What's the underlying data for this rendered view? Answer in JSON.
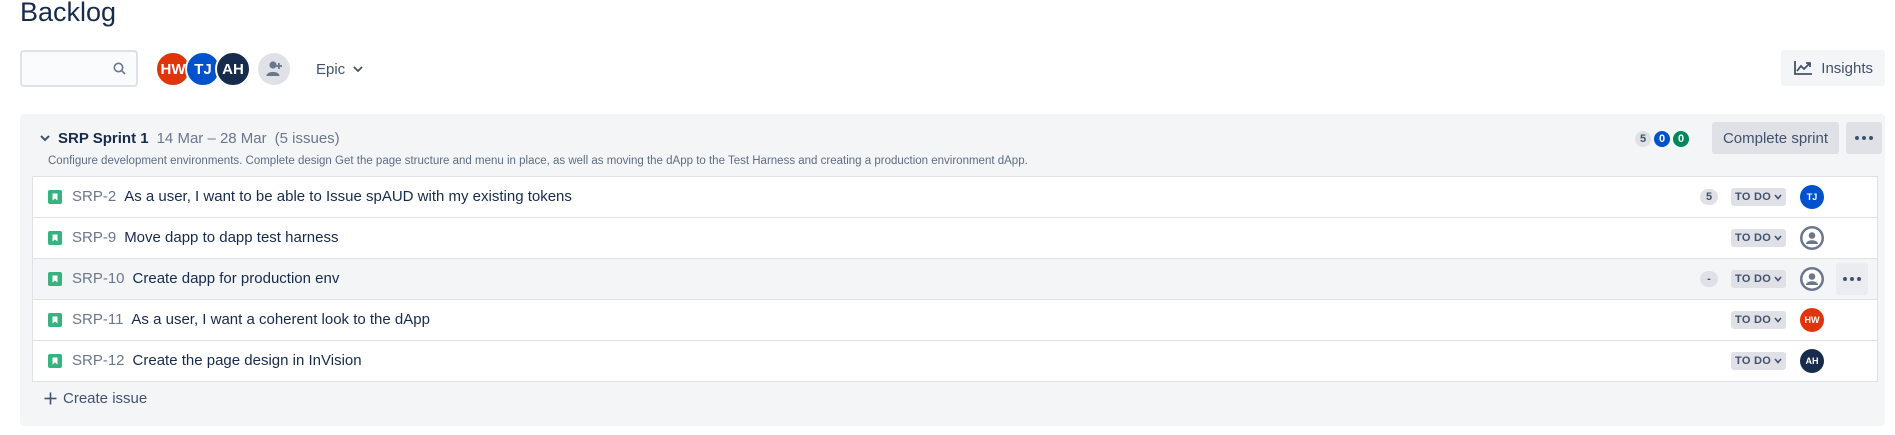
{
  "page": {
    "title": "Backlog"
  },
  "toolbar": {
    "avatars": [
      {
        "initials": "HW",
        "color": "#de350b"
      },
      {
        "initials": "TJ",
        "color": "#0052cc"
      },
      {
        "initials": "AH",
        "color": "#172b4d"
      }
    ],
    "add_people_icon": "person-add-icon",
    "epic_label": "Epic",
    "insights_label": "Insights"
  },
  "sprint": {
    "name": "SRP Sprint 1",
    "dates": "14 Mar – 28 Mar",
    "issue_count": "(5 issues)",
    "goal": "Configure development environments. Complete design Get the page structure and menu in place, as well as moving the dApp to the Test Harness and creating a production environment dApp.",
    "points_todo": "5",
    "points_in_progress": "0",
    "points_done": "0",
    "complete_label": "Complete sprint",
    "issues": [
      {
        "key": "SRP-2",
        "summary": "As a user, I want to be able to Issue spAUD with my existing tokens",
        "estimate": "5",
        "status": "TO DO",
        "assignee": "TJ",
        "assignee_color": "#0052cc"
      },
      {
        "key": "SRP-9",
        "summary": "Move dapp to dapp test harness",
        "estimate": "",
        "status": "TO DO",
        "assignee": "",
        "assignee_color": ""
      },
      {
        "key": "SRP-10",
        "summary": "Create dapp for production env",
        "estimate": "-",
        "status": "TO DO",
        "assignee": "",
        "assignee_color": ""
      },
      {
        "key": "SRP-11",
        "summary": "As a user, I want a coherent look to the dApp",
        "estimate": "",
        "status": "TO DO",
        "assignee": "HW",
        "assignee_color": "#de350b"
      },
      {
        "key": "SRP-12",
        "summary": "Create the page design in InVision",
        "estimate": "",
        "status": "TO DO",
        "assignee": "AH",
        "assignee_color": "#172b4d"
      }
    ],
    "create_issue_label": "Create issue"
  }
}
